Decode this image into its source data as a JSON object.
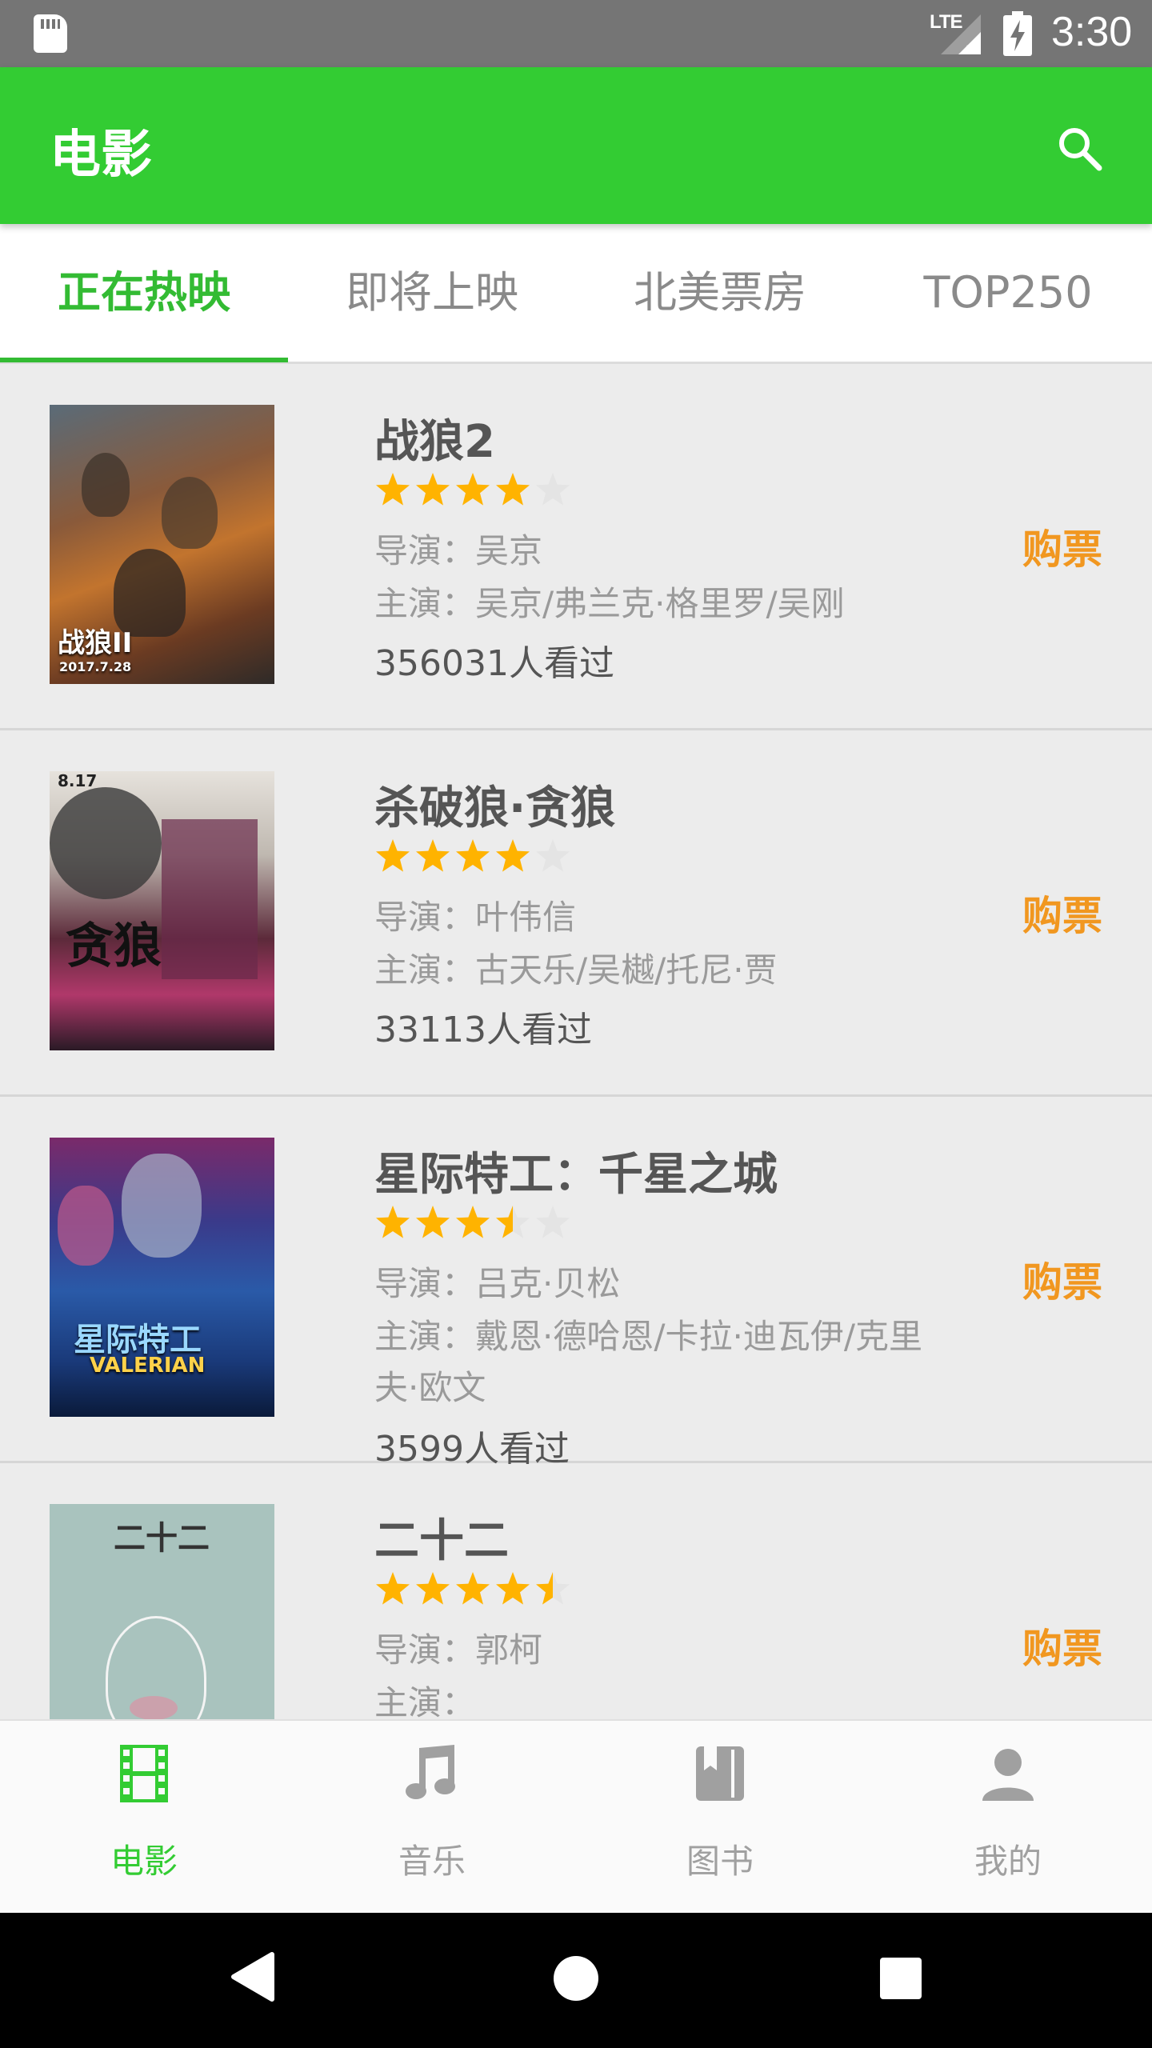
{
  "status_bar": {
    "network": "LTE",
    "time": "3:30"
  },
  "app_bar": {
    "title": "电影"
  },
  "tabs": [
    {
      "label": "正在热映",
      "active": true
    },
    {
      "label": "即将上映",
      "active": false
    },
    {
      "label": "北美票房",
      "active": false
    },
    {
      "label": "TOP250",
      "active": false
    }
  ],
  "movies": [
    {
      "title": "战狼2",
      "rating_stars": 4.0,
      "director": "导演：吴京",
      "cast": "主演：吴京/弗兰克·格里罗/吴刚",
      "watched": "356031人看过",
      "buy_label": "购票"
    },
    {
      "title": "杀破狼·贪狼",
      "rating_stars": 4.0,
      "director": "导演：叶伟信",
      "cast": "主演：古天乐/吴樾/托尼·贾",
      "watched": "33113人看过",
      "buy_label": "购票"
    },
    {
      "title": "星际特工：千星之城",
      "rating_stars": 3.5,
      "director": "导演：吕克·贝松",
      "cast": "主演：戴恩·德哈恩/卡拉·迪瓦伊/克里夫·欧文",
      "watched": "3599人看过",
      "buy_label": "购票"
    },
    {
      "title": "二十二",
      "rating_stars": 4.5,
      "director": "导演：郭柯",
      "cast": "主演：",
      "watched": "",
      "buy_label": "购票"
    }
  ],
  "bottom_nav": [
    {
      "label": "电影",
      "icon": "film-icon",
      "active": true
    },
    {
      "label": "音乐",
      "icon": "music-note-icon",
      "active": false
    },
    {
      "label": "图书",
      "icon": "book-icon",
      "active": false
    },
    {
      "label": "我的",
      "icon": "person-icon",
      "active": false
    }
  ],
  "colors": {
    "primary": "#33cc33",
    "accent_buy": "#f19720",
    "star": "#ffb300"
  }
}
